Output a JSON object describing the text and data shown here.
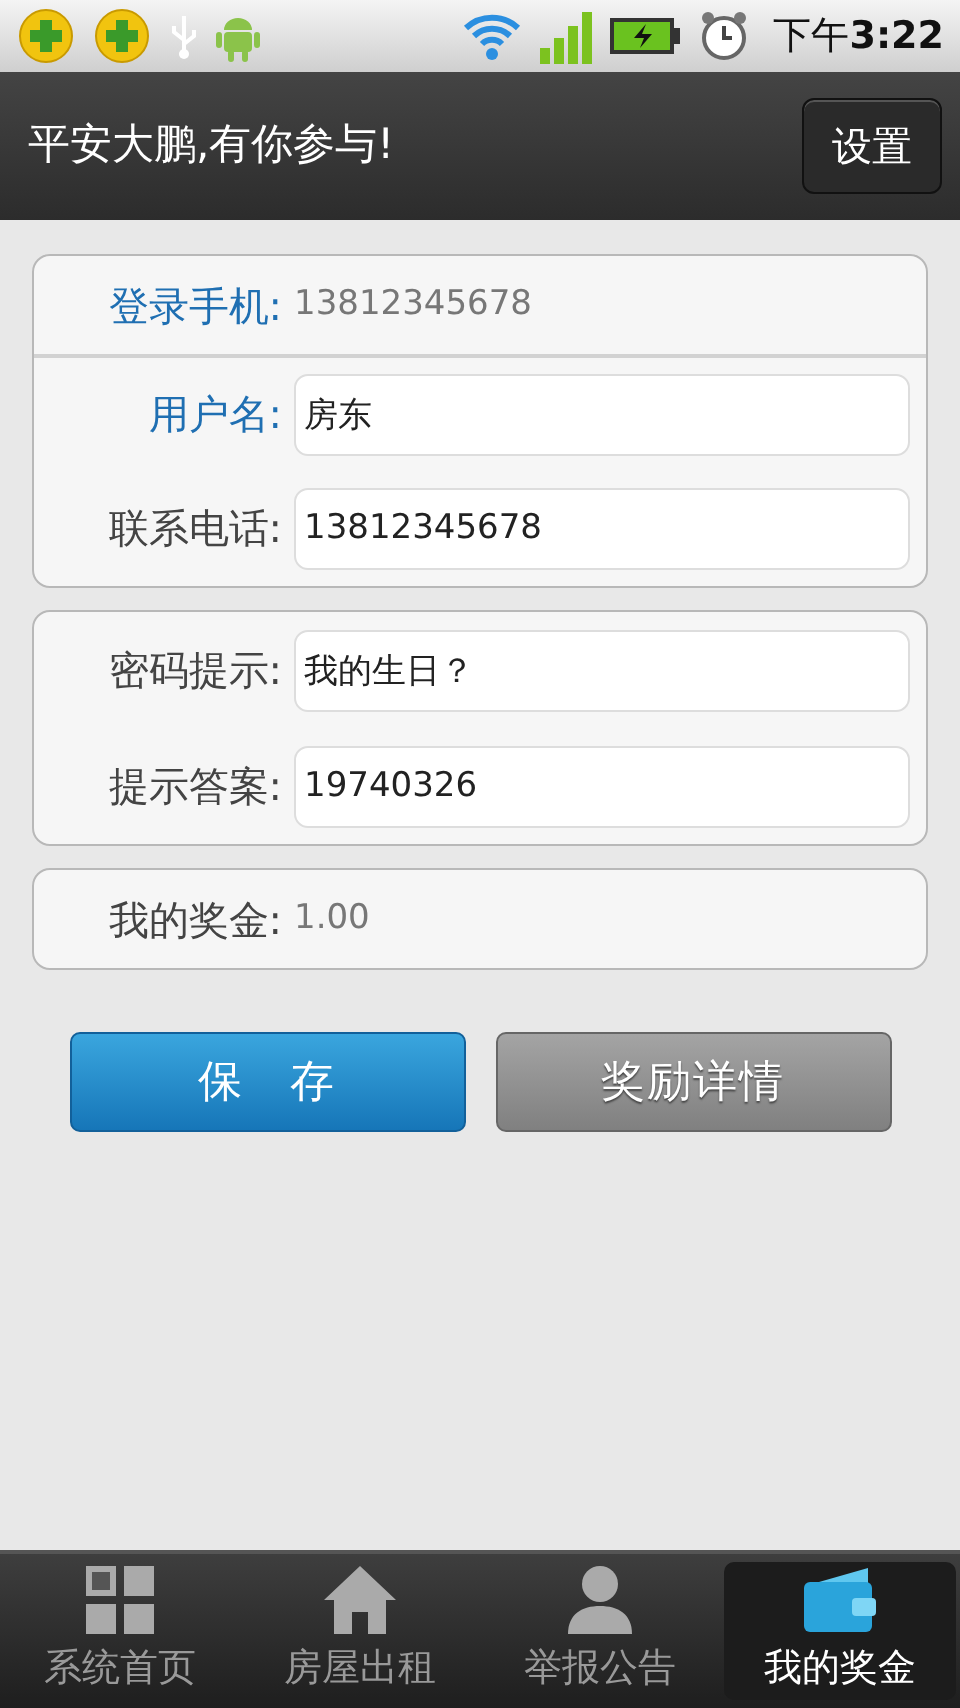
{
  "status_bar": {
    "time": "下午**3:22**"
  },
  "header": {
    "title": "平安大鹏,有你参与!",
    "button": "设置"
  },
  "groups": [
    {
      "rows": [
        {
          "kind": "static",
          "label": "登录手机:",
          "value": "13812345678",
          "color": "#1f6fb2"
        },
        {
          "kind": "input",
          "label": "用户名:",
          "value": "房东",
          "color": "#1f6fb2"
        },
        {
          "kind": "input",
          "label": "联系电话:",
          "value": "13812345678",
          "color": "#444444"
        }
      ]
    },
    {
      "rows": [
        {
          "kind": "input",
          "label": "密码提示:",
          "value": "我的生日？",
          "color": "#444444"
        },
        {
          "kind": "input",
          "label": "提示答案:",
          "value": "19740326",
          "color": "#444444"
        }
      ]
    },
    {
      "rows": [
        {
          "kind": "static",
          "label": "我的奖金:",
          "value": "1.00",
          "color": "#444444"
        }
      ]
    }
  ],
  "buttons": [
    {
      "kind": "primary",
      "label": "保　存"
    },
    {
      "kind": "secondary",
      "label": "奖励详情"
    }
  ],
  "tabs": [
    {
      "kind": "grid",
      "label": "系统首页",
      "selected": false
    },
    {
      "kind": "home",
      "label": "房屋出租",
      "selected": false
    },
    {
      "kind": "person",
      "label": "举报公告",
      "selected": false
    },
    {
      "kind": "wallet",
      "label": "我的奖金",
      "selected": true
    }
  ]
}
